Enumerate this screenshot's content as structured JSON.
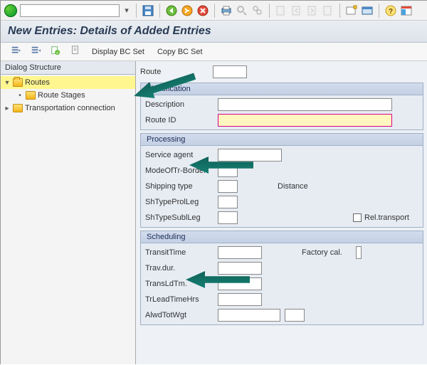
{
  "title": "New Entries: Details of Added Entries",
  "cmd_value": "",
  "app_toolbar": {
    "display_bc": "Display BC Set",
    "copy_bc": "Copy BC Set"
  },
  "dialog_header": "Dialog Structure",
  "tree": {
    "routes": "Routes",
    "route_stages": "Route Stages",
    "transport_conn": "Transportation connection"
  },
  "route_label": "Route",
  "route_value": "",
  "identification": {
    "header": "Identification",
    "description_label": "Description",
    "description_value": "",
    "route_id_label": "Route ID",
    "route_id_value": ""
  },
  "processing": {
    "header": "Processing",
    "service_agent_label": "Service agent",
    "service_agent_value": "",
    "mode_label": "ModeOfTr-Border",
    "mode_value": "",
    "shipping_type_label": "Shipping type",
    "shipping_type_value": "",
    "distance_label": "Distance",
    "shtype_prol_label": "ShTypeProlLeg",
    "shtype_prol_value": "",
    "shtype_subl_label": "ShTypeSublLeg",
    "shtype_subl_value": "",
    "rel_transport_label": "Rel.transport"
  },
  "scheduling": {
    "header": "Scheduling",
    "transit_time_label": "TransitTime",
    "transit_time_value": "",
    "trav_dur_label": "Trav.dur.",
    "trav_dur_value": "",
    "translutm_label": "TransLdTm.",
    "translutm_value": "",
    "tr_lead_label": "TrLeadTimeHrs",
    "tr_lead_value": "",
    "alwd_label": "AlwdTotWgt",
    "alwd_value": "",
    "alwd_uom_value": "",
    "factory_cal_label": "Factory cal."
  }
}
